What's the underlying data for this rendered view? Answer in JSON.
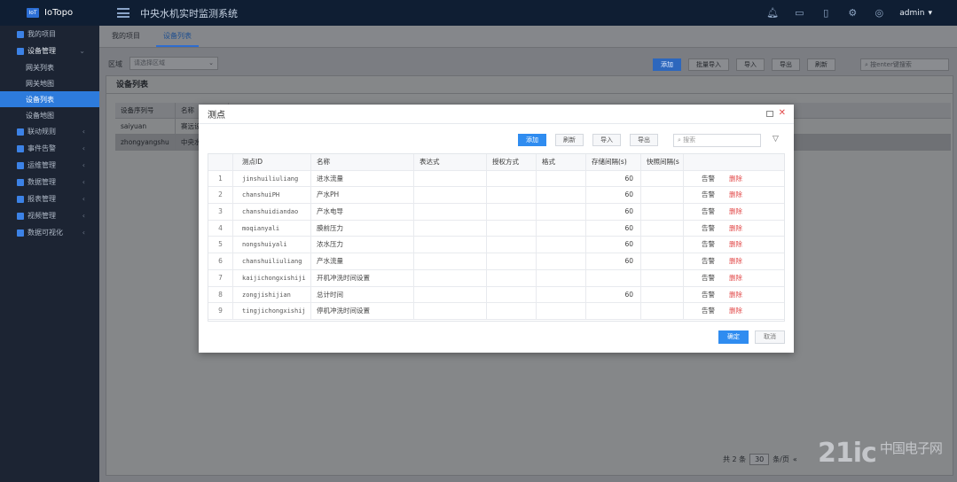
{
  "app": {
    "logo_badge": "IoT",
    "name": "IoTopo",
    "system_title": "中央水机实时监测系统",
    "user": "admin"
  },
  "sidebar": {
    "items": [
      {
        "label": "我的项目",
        "type": "item"
      },
      {
        "label": "设备管理",
        "type": "group"
      },
      {
        "label": "网关列表",
        "type": "sub"
      },
      {
        "label": "网关地图",
        "type": "sub"
      },
      {
        "label": "设备列表",
        "type": "sub",
        "active": true
      },
      {
        "label": "设备地图",
        "type": "sub"
      },
      {
        "label": "联动规则",
        "type": "item"
      },
      {
        "label": "事件告警",
        "type": "item"
      },
      {
        "label": "运维管理",
        "type": "item"
      },
      {
        "label": "数据管理",
        "type": "item"
      },
      {
        "label": "报表管理",
        "type": "item"
      },
      {
        "label": "视频管理",
        "type": "item"
      },
      {
        "label": "数据可视化",
        "type": "item"
      }
    ]
  },
  "tabs": [
    {
      "label": "我的项目"
    },
    {
      "label": "设备列表",
      "active": true
    }
  ],
  "filter": {
    "area_label": "区域",
    "area_placeholder": "请选择区域",
    "buttons": [
      "添加",
      "批量导入",
      "导入",
      "导出",
      "刷新"
    ],
    "search_placeholder": "按enter键搜索"
  },
  "device_panel": {
    "title": "设备列表",
    "headers": [
      "设备序列号",
      "名称"
    ],
    "rows": [
      [
        "saiyuan",
        "赛远设"
      ],
      [
        "zhongyangshu",
        "中央水"
      ]
    ]
  },
  "pager": {
    "total": "共 2 条",
    "page_size": "30",
    "unit": "条/页",
    "prev": "«"
  },
  "watermark": {
    "main": "21ic",
    "suffix": "中国电子网"
  },
  "modal": {
    "title": "测点",
    "toolbar": [
      "添加",
      "刷新",
      "导入",
      "导出"
    ],
    "search_placeholder": "搜索",
    "headers": [
      "测点ID",
      "名称",
      "表达式",
      "授权方式",
      "格式",
      "存储间隔(s)",
      "快照间隔(s"
    ],
    "rows": [
      {
        "index": "1",
        "id": "jinshuiliuliang",
        "name": "进水流量",
        "storage": "60"
      },
      {
        "index": "2",
        "id": "chanshuiPH",
        "name": "产水PH",
        "storage": "60"
      },
      {
        "index": "3",
        "id": "chanshuidiandao",
        "name": "产水电导",
        "storage": "60"
      },
      {
        "index": "4",
        "id": "moqianyali",
        "name": "膜前压力",
        "storage": "60"
      },
      {
        "index": "5",
        "id": "nongshuiyali",
        "name": "浓水压力",
        "storage": "60"
      },
      {
        "index": "6",
        "id": "chanshuiliuliang",
        "name": "产水流量",
        "storage": "60"
      },
      {
        "index": "7",
        "id": "kaijichongxishiji",
        "name": "开机冲洗时间设置",
        "storage": ""
      },
      {
        "index": "8",
        "id": "zongjishijian",
        "name": "总计时间",
        "storage": "60"
      },
      {
        "index": "9",
        "id": "tingjichongxishij",
        "name": "停机冲洗时间设置",
        "storage": ""
      }
    ],
    "op_alarm": "告警",
    "op_delete": "删除",
    "confirm": "确定",
    "cancel": "取消"
  },
  "colors": {
    "topbar": "#0f1e33",
    "sidebar": "#1c2433",
    "active": "#2d7bdc",
    "primary": "#2f8cf0",
    "danger": "#e24a4a"
  }
}
